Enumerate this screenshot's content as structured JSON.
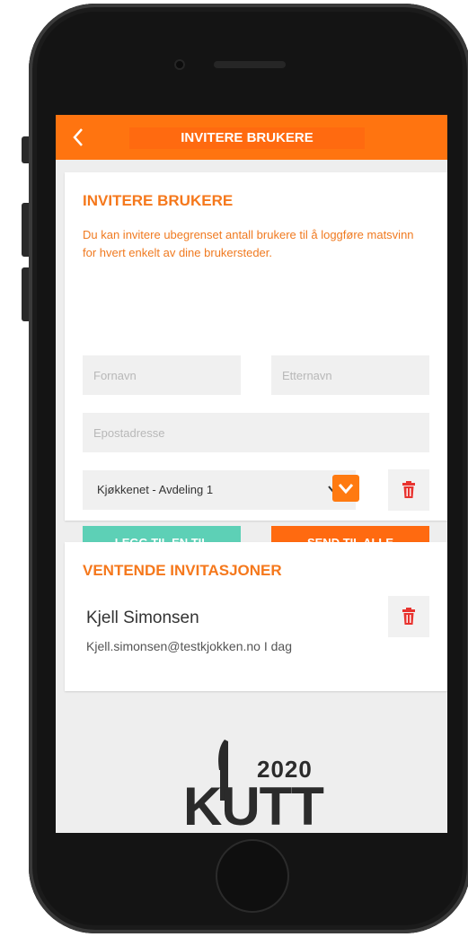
{
  "header": {
    "back_icon": "chevron-left-icon",
    "title": "INVITERE BRUKERE"
  },
  "invite": {
    "heading": "INVITERE BRUKERE",
    "description": "Du kan invitere ubegrenset antall brukere til å loggføre matsvinn for hvert enkelt av dine brukersteder.",
    "first_name_placeholder": "Fornavn",
    "last_name_placeholder": "Etternavn",
    "email_placeholder": "Epostadresse",
    "location_selected": "Kjøkkenet - Avdeling 1",
    "add_button": "LEGG TIL EN TIL",
    "send_button": "SEND TIL ALLE"
  },
  "pending": {
    "heading": "VENTENDE INVITASJONER",
    "items": [
      {
        "name": "Kjell Simonsen",
        "details": "Kjell.simonsen@testkjokken.no I dag"
      }
    ]
  },
  "footer_logo": {
    "year": "2020",
    "word": "KUTT"
  },
  "colors": {
    "brand_orange": "#ff7410",
    "accent_green": "#5dd0b6",
    "delete_red": "#e8332f"
  }
}
